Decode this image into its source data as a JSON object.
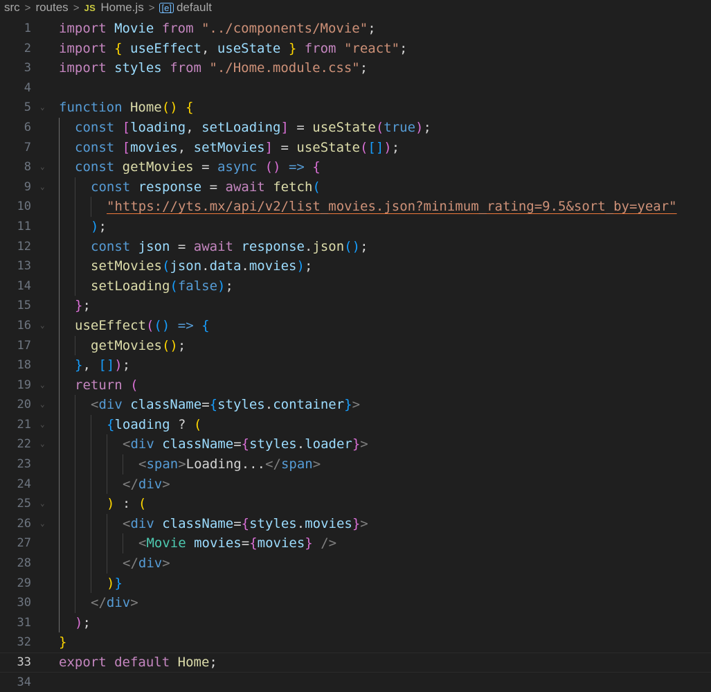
{
  "breadcrumb": {
    "items": [
      "src",
      "routes",
      "Home.js",
      "default"
    ],
    "file_icon": "JS",
    "symbol_icon": "[e]"
  },
  "line_numbers": [
    "1",
    "2",
    "3",
    "4",
    "5",
    "6",
    "7",
    "8",
    "9",
    "10",
    "11",
    "12",
    "13",
    "14",
    "15",
    "16",
    "17",
    "18",
    "19",
    "20",
    "21",
    "22",
    "23",
    "24",
    "25",
    "26",
    "27",
    "28",
    "29",
    "30",
    "31",
    "32",
    "33",
    "34"
  ],
  "code": {
    "l1": [
      "import",
      "Movie",
      "from",
      "\"../components/Movie\"",
      ";"
    ],
    "l2": [
      "import",
      "{",
      "useEffect",
      ",",
      "useState",
      "}",
      "from",
      "\"react\"",
      ";"
    ],
    "l3": [
      "import",
      "styles",
      "from",
      "\"./Home.module.css\"",
      ";"
    ],
    "l5": [
      "function",
      "Home",
      "(",
      ")",
      "{"
    ],
    "l6": [
      "const",
      "[",
      "loading",
      ",",
      "setLoading",
      "]",
      "=",
      "useState",
      "(",
      "true",
      ")",
      ";"
    ],
    "l7": [
      "const",
      "[",
      "movies",
      ",",
      "setMovies",
      "]",
      "=",
      "useState",
      "(",
      "[",
      "]",
      ")",
      ";"
    ],
    "l8": [
      "const",
      "getMovies",
      "=",
      "async",
      "(",
      ")",
      "=>",
      "{"
    ],
    "l9": [
      "const",
      "response",
      "=",
      "await",
      "fetch",
      "("
    ],
    "l10": [
      "\"https://yts.mx/api/v2/list_movies.json?minimum_rating=9.5&sort_by=year\""
    ],
    "l11": [
      ")",
      ";"
    ],
    "l12": [
      "const",
      "json",
      "=",
      "await",
      "response",
      ".",
      "json",
      "(",
      ")",
      ";"
    ],
    "l13": [
      "setMovies",
      "(",
      "json",
      ".",
      "data",
      ".",
      "movies",
      ")",
      ";"
    ],
    "l14": [
      "setLoading",
      "(",
      "false",
      ")",
      ";"
    ],
    "l15": [
      "}",
      ";"
    ],
    "l16": [
      "useEffect",
      "(",
      "(",
      ")",
      "=>",
      "{"
    ],
    "l17": [
      "getMovies",
      "(",
      ")",
      ";"
    ],
    "l18": [
      "}",
      ",",
      "[",
      "]",
      ")",
      ";"
    ],
    "l19": [
      "return",
      "("
    ],
    "l20": [
      "<",
      "div",
      "className",
      "=",
      "{",
      "styles",
      ".",
      "container",
      "}",
      ">"
    ],
    "l21": [
      "{",
      "loading",
      "?",
      "("
    ],
    "l22": [
      "<",
      "div",
      "className",
      "=",
      "{",
      "styles",
      ".",
      "loader",
      "}",
      ">"
    ],
    "l23": [
      "<",
      "span",
      ">",
      "Loading...",
      "</",
      "span",
      ">"
    ],
    "l24": [
      "</",
      "div",
      ">"
    ],
    "l25": [
      ")",
      ":",
      "("
    ],
    "l26": [
      "<",
      "div",
      "className",
      "=",
      "{",
      "styles",
      ".",
      "movies",
      "}",
      ">"
    ],
    "l27": [
      "<",
      "Movie",
      "movies",
      "=",
      "{",
      "movies",
      "}",
      "/>"
    ],
    "l28": [
      "</",
      "div",
      ">"
    ],
    "l29": [
      ")",
      "}"
    ],
    "l30": [
      "</",
      "div",
      ">"
    ],
    "l31": [
      ")",
      ";"
    ],
    "l32": [
      "}"
    ],
    "l33": [
      "export",
      "default",
      "Home",
      ";"
    ]
  },
  "colors": {
    "background": "#1f1f1f",
    "keyword": "#569cd6",
    "control": "#c586c0",
    "variable": "#9cdcfe",
    "function": "#dcdcaa",
    "string": "#ce9178",
    "component": "#4ec9b0",
    "bracket_1": "#ffd700",
    "bracket_2": "#da70d6",
    "bracket_3": "#179fff"
  },
  "editor": {
    "current_line": "33"
  }
}
